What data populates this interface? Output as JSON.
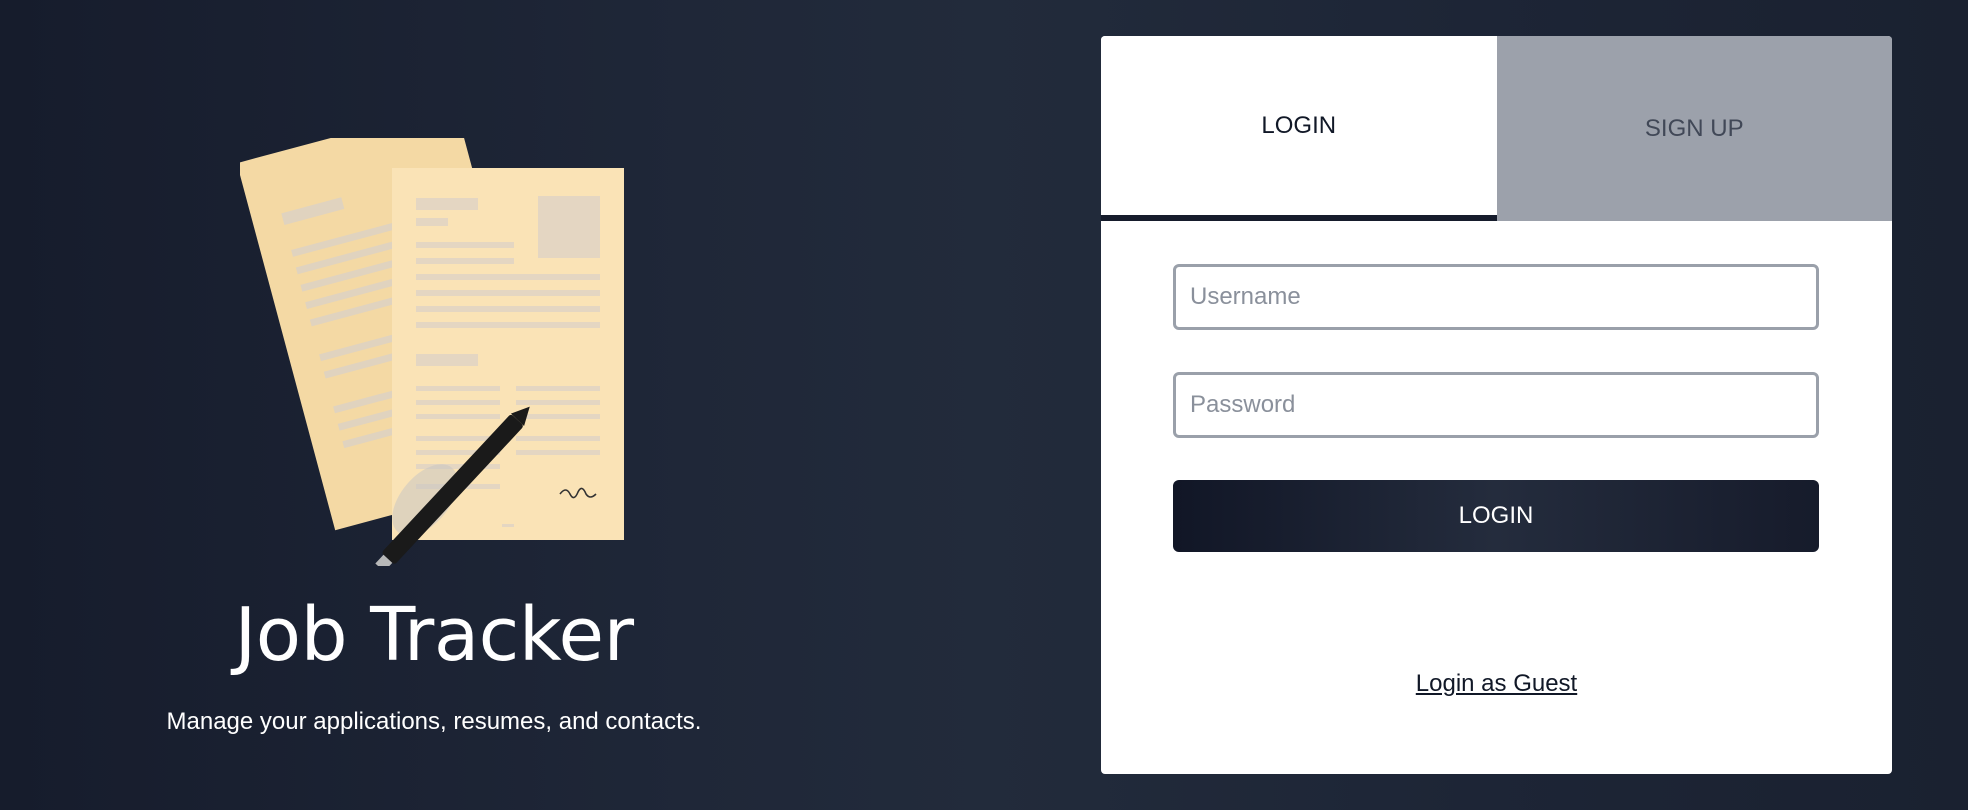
{
  "hero": {
    "illustration_icon": "documents-with-pen-icon",
    "title": "Job Tracker",
    "subtitle": "Manage your applications, resumes, and contacts."
  },
  "auth_card": {
    "tabs": [
      {
        "label": "LOGIN",
        "active": true
      },
      {
        "label": "SIGN UP",
        "active": false
      }
    ],
    "username": {
      "placeholder": "Username",
      "value": ""
    },
    "password": {
      "placeholder": "Password",
      "value": ""
    },
    "submit_label": "LOGIN",
    "guest_link_label": "Login as Guest"
  },
  "colors": {
    "background": "#1f2738",
    "card": "#ffffff",
    "inactive_tab": "#9ca1ab",
    "button": "#161c2c",
    "paper": "#fae3b6"
  }
}
